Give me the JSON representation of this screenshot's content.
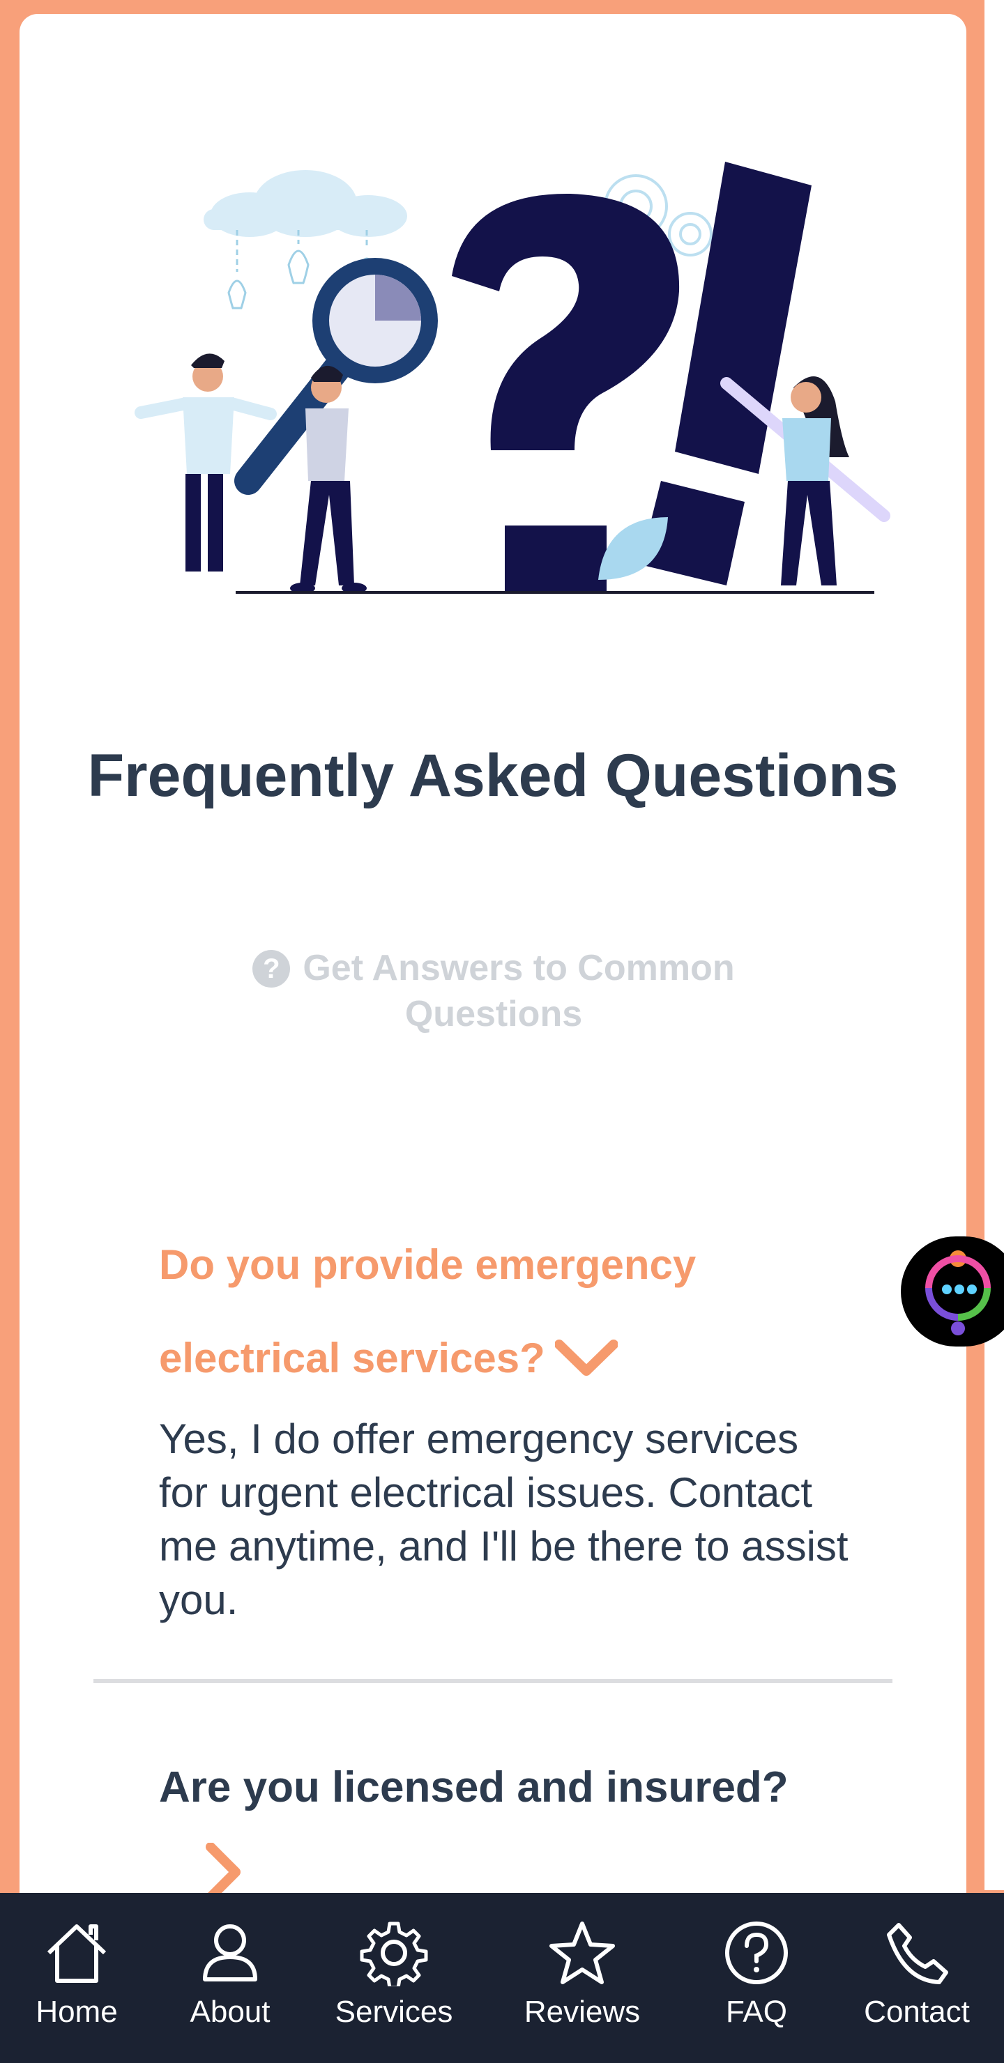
{
  "colors": {
    "frame": "#f8a07a",
    "accent": "#f69a6c",
    "heading": "#2d3b4e",
    "muted": "#cfd3d8",
    "nav_bg": "#1b2232",
    "illustration_navy": "#13124a"
  },
  "hero": {
    "image_name": "faq-illustration"
  },
  "page_title": "Frequently Asked Questions",
  "subtitle": {
    "icon": "question-circle-icon",
    "text": "Get Answers to Common Questions"
  },
  "faq": {
    "items": [
      {
        "question": "Do you provide emergency electrical services?",
        "answer": "Yes, I do offer emergency services for urgent electrical issues. Contact me anytime, and I'll be there to assist you.",
        "expanded": true,
        "icon": "chevron-down-icon"
      },
      {
        "question": "Are you licensed and insured?",
        "expanded": false,
        "icon": "chevron-right-icon"
      }
    ]
  },
  "chat_widget": {
    "icon": "chat-icon"
  },
  "bottom_nav": {
    "items": [
      {
        "label": "Home",
        "icon": "home-icon"
      },
      {
        "label": "About",
        "icon": "user-icon"
      },
      {
        "label": "Services",
        "icon": "gear-icon"
      },
      {
        "label": "Reviews",
        "icon": "star-icon"
      },
      {
        "label": "FAQ",
        "icon": "question-circle-icon"
      },
      {
        "label": "Contact",
        "icon": "phone-icon"
      }
    ]
  }
}
